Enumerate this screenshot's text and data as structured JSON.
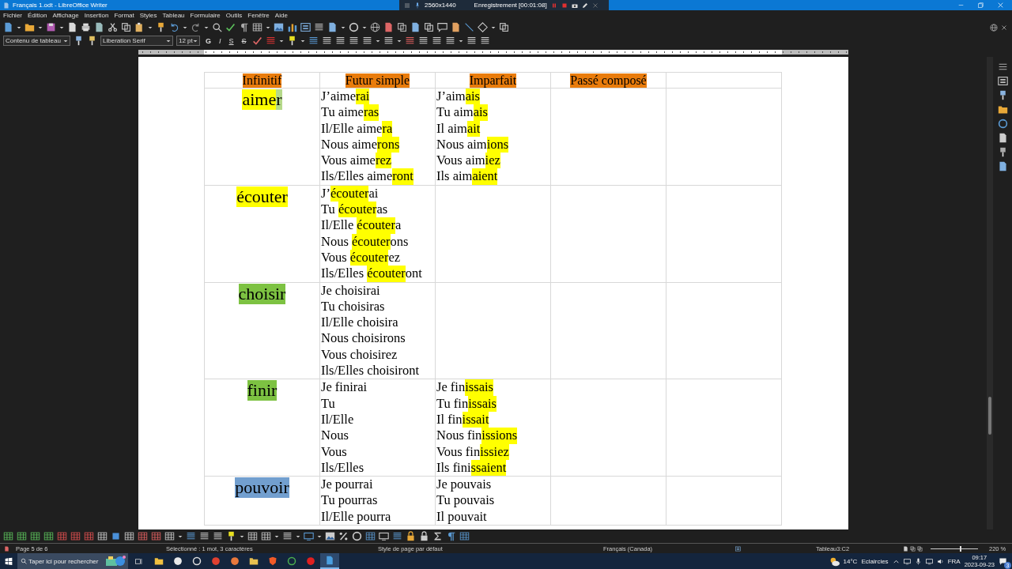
{
  "window": {
    "title": "Français 1.odt - LibreOffice Writer"
  },
  "recorder": {
    "resolution": "2560x1440",
    "status": "Enregistrement [00:01:08]"
  },
  "menu": [
    "Fichier",
    "Édition",
    "Affichage",
    "Insertion",
    "Format",
    "Styles",
    "Tableau",
    "Formulaire",
    "Outils",
    "Fenêtre",
    "Aide"
  ],
  "formatting": {
    "paragraph_style": "Contenu de tableau",
    "font": "Liberation Serif",
    "size": "12 pt",
    "buttons": [
      {
        "label": "G",
        "kind": "bold"
      },
      {
        "label": "I",
        "kind": "italic"
      },
      {
        "label": "S",
        "kind": "underline"
      },
      {
        "label": "S",
        "kind": "strike"
      }
    ]
  },
  "table": {
    "columns": [
      {
        "label": "Infinitif",
        "color": "#e97c0c"
      },
      {
        "label": "Futur simple",
        "color": "#e97c0c"
      },
      {
        "label": "Imparfait",
        "color": "#e97c0c"
      },
      {
        "label": "Passé composé",
        "color": "#e97c0c"
      }
    ],
    "rows": [
      {
        "verb": [
          {
            "text": "aime",
            "color": "#ffff00"
          },
          {
            "text": "r",
            "color": "#b5d98a"
          }
        ],
        "futur": [
          [
            {
              "text": "J’aime"
            },
            {
              "text": "rai",
              "color": "#ffff00"
            }
          ],
          [
            {
              "text": "Tu aime"
            },
            {
              "text": "ras",
              "color": "#ffff00"
            }
          ],
          [
            {
              "text": "Il/Elle aime"
            },
            {
              "text": "ra",
              "color": "#ffff00"
            }
          ],
          [
            {
              "text": "Nous aime"
            },
            {
              "text": "rons",
              "color": "#ffff00"
            }
          ],
          [
            {
              "text": "Vous aime"
            },
            {
              "text": "rez",
              "color": "#ffff00"
            }
          ],
          [
            {
              "text": "Ils/Elles aime"
            },
            {
              "text": "ront",
              "color": "#ffff00"
            }
          ]
        ],
        "imparfait": [
          [
            {
              "text": "J’aim"
            },
            {
              "text": "ais",
              "color": "#ffff00"
            }
          ],
          [
            {
              "text": "Tu aim"
            },
            {
              "text": "ais",
              "color": "#ffff00"
            }
          ],
          [
            {
              "text": "Il aim"
            },
            {
              "text": "ait",
              "color": "#ffff00"
            }
          ],
          [
            {
              "text": "Nous aim"
            },
            {
              "text": "ions",
              "color": "#ffff00"
            }
          ],
          [
            {
              "text": "Vous aim"
            },
            {
              "text": "iez",
              "color": "#ffff00"
            }
          ],
          [
            {
              "text": "Ils aim"
            },
            {
              "text": "aient",
              "color": "#ffff00"
            }
          ]
        ]
      },
      {
        "verb": [
          {
            "text": "écouter",
            "color": "#ffff00"
          }
        ],
        "futur": [
          [
            {
              "text": "J’"
            },
            {
              "text": "écouter",
              "color": "#ffff00"
            },
            {
              "text": "ai"
            }
          ],
          [
            {
              "text": "Tu "
            },
            {
              "text": "écouter",
              "color": "#ffff00"
            },
            {
              "text": "as"
            }
          ],
          [
            {
              "text": "Il/Elle "
            },
            {
              "text": "écouter",
              "color": "#ffff00"
            },
            {
              "text": "a"
            }
          ],
          [
            {
              "text": "Nous "
            },
            {
              "text": "écouter",
              "color": "#ffff00"
            },
            {
              "text": "ons"
            }
          ],
          [
            {
              "text": "Vous "
            },
            {
              "text": "écouter",
              "color": "#ffff00"
            },
            {
              "text": "ez"
            }
          ],
          [
            {
              "text": "Ils/Elles "
            },
            {
              "text": "écouter",
              "color": "#ffff00"
            },
            {
              "text": "ont"
            }
          ]
        ]
      },
      {
        "verb": [
          {
            "text": "choisir",
            "color": "#7dc242"
          }
        ],
        "futur": [
          [
            {
              "text": "Je choisirai"
            }
          ],
          [
            {
              "text": "Tu choisiras"
            }
          ],
          [
            {
              "text": "Il/Elle choisira"
            }
          ],
          [
            {
              "text": "Nous choisirons"
            }
          ],
          [
            {
              "text": "Vous choisirez"
            }
          ],
          [
            {
              "text": "Ils/Elles choisiront"
            }
          ]
        ]
      },
      {
        "verb": [
          {
            "text": "finir",
            "color": "#7dc242"
          }
        ],
        "futur": [
          [
            {
              "text": "Je finirai"
            }
          ],
          [
            {
              "text": "Tu"
            }
          ],
          [
            {
              "text": "Il/Elle"
            }
          ],
          [
            {
              "text": "Nous"
            }
          ],
          [
            {
              "text": "Vous"
            }
          ],
          [
            {
              "text": "Ils/Elles"
            }
          ]
        ],
        "imparfait": [
          [
            {
              "text": "Je fin"
            },
            {
              "text": "issais",
              "color": "#ffff00"
            }
          ],
          [
            {
              "text": "Tu fin"
            },
            {
              "text": "issais",
              "color": "#ffff00"
            }
          ],
          [
            {
              "text": "Il fin"
            },
            {
              "text": "issait",
              "color": "#ffff00"
            }
          ],
          [
            {
              "text": "Nous fin"
            },
            {
              "text": "issions",
              "color": "#ffff00"
            }
          ],
          [
            {
              "text": "Vous fin"
            },
            {
              "text": "issiez",
              "color": "#ffff00"
            }
          ],
          [
            {
              "text": "Ils fini"
            },
            {
              "text": "ssaient",
              "color": "#ffff00"
            }
          ]
        ]
      },
      {
        "verb": [
          {
            "text": "pouvoir",
            "color": "#729fcf"
          }
        ],
        "futur": [
          [
            {
              "text": "Je pourrai"
            }
          ],
          [
            {
              "text": "Tu pourras"
            }
          ],
          [
            {
              "text": "Il/Elle pourra"
            }
          ]
        ],
        "imparfait": [
          [
            {
              "text": "Je pouvais"
            }
          ],
          [
            {
              "text": "Tu pouvais"
            }
          ],
          [
            {
              "text": "Il pouvait"
            }
          ]
        ]
      }
    ]
  },
  "status_bar": {
    "page": "Page 5 de 6",
    "selection": "Sélectionné : 1 mot, 3 caractères",
    "page_style": "Style de page par défaut",
    "language": "Français (Canada)",
    "cell": "Tableau3:C2",
    "zoom": {
      "label": "220 %",
      "level": 0.62
    }
  },
  "taskbar": {
    "search": {
      "placeholder": "Taper ici pour rechercher"
    },
    "temperature": "14°C",
    "weather": "Eclaircies",
    "language": "FRA",
    "time": "09:17",
    "date": "2023-09-23",
    "notifications": "3"
  }
}
